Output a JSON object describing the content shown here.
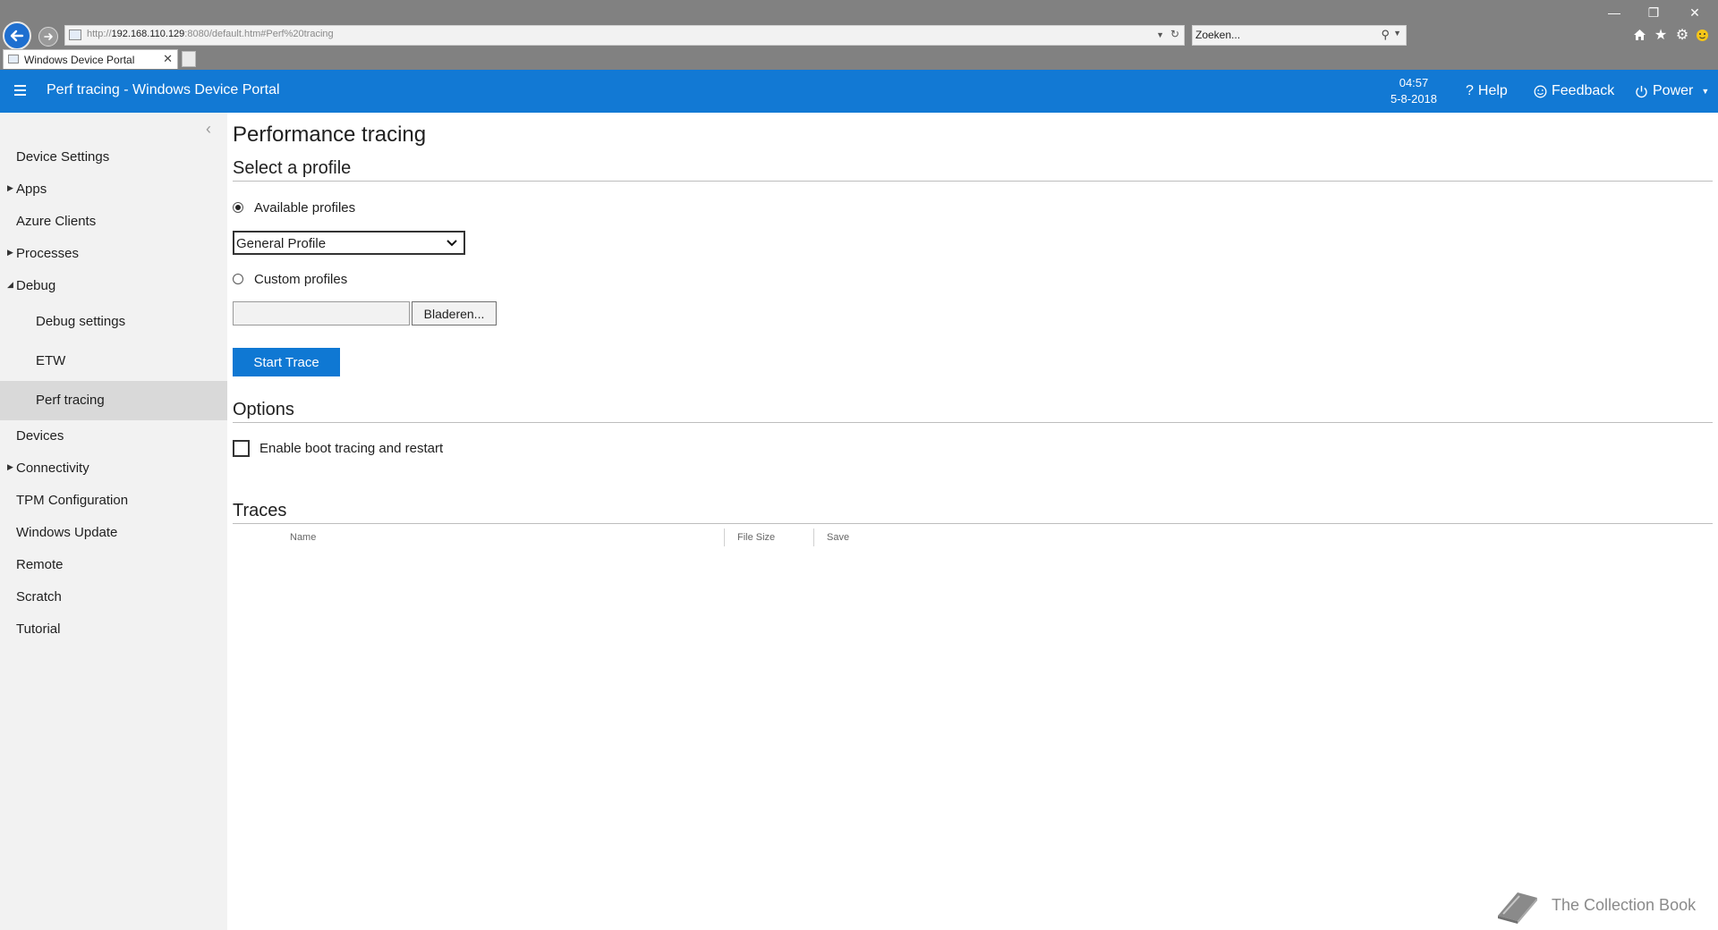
{
  "browser": {
    "url_prefix": "http://",
    "url_host": "192.168.110.129",
    "url_rest": ":8080/default.htm#Perf%20tracing",
    "search_placeholder": "Zoeken...",
    "tab_title": "Windows Device Portal"
  },
  "header": {
    "title": "Perf tracing - Windows Device Portal",
    "time": "04:57",
    "date": "5-8-2018",
    "help_label": "Help",
    "feedback_label": "Feedback",
    "power_label": "Power"
  },
  "sidebar": {
    "items": [
      {
        "label": "Device Settings"
      },
      {
        "label": "Apps"
      },
      {
        "label": "Azure Clients"
      },
      {
        "label": "Processes"
      },
      {
        "label": "Debug"
      },
      {
        "label": "Debug settings"
      },
      {
        "label": "ETW"
      },
      {
        "label": "Perf tracing"
      },
      {
        "label": "Devices"
      },
      {
        "label": "Connectivity"
      },
      {
        "label": "TPM Configuration"
      },
      {
        "label": "Windows Update"
      },
      {
        "label": "Remote"
      },
      {
        "label": "Scratch"
      },
      {
        "label": "Tutorial"
      }
    ]
  },
  "main": {
    "title": "Performance tracing",
    "select_profile_heading": "Select a profile",
    "available_profiles_label": "Available profiles",
    "profile_selected": "General Profile",
    "custom_profiles_label": "Custom profiles",
    "browse_label": "Bladeren...",
    "start_trace_label": "Start Trace",
    "options_heading": "Options",
    "boot_tracing_label": "Enable boot tracing and restart",
    "traces_heading": "Traces",
    "traces_columns": [
      "Name",
      "File Size",
      "Save"
    ]
  },
  "watermark": "The Collection Book",
  "colors": {
    "accent": "#1279d4",
    "button": "#0f78d3",
    "sidebar_bg": "#f2f2f2",
    "sidebar_active": "#d9d9d9",
    "chrome": "#818181"
  }
}
